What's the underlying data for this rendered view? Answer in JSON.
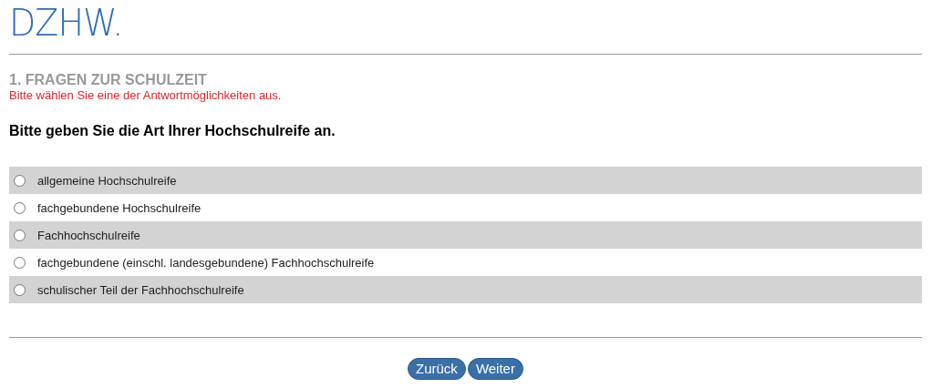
{
  "logo": "DZHW.",
  "section": {
    "title": "1. FRAGEN ZUR SCHULZEIT",
    "error": "Bitte wählen Sie eine der Antwortmöglichkeiten aus."
  },
  "question": "Bitte geben Sie die Art Ihrer Hochschulreife an.",
  "options": [
    {
      "label": "allgemeine Hochschulreife",
      "selected": false
    },
    {
      "label": "fachgebundene Hochschulreife",
      "selected": false
    },
    {
      "label": "Fachhochschulreife",
      "selected": false
    },
    {
      "label": "fachgebundene (einschl. landesgebundene) Fachhochschulreife",
      "selected": false
    },
    {
      "label": "schulischer Teil der Fachhochschulreife",
      "selected": false
    }
  ],
  "buttons": [
    "Zurück",
    "Weiter"
  ]
}
